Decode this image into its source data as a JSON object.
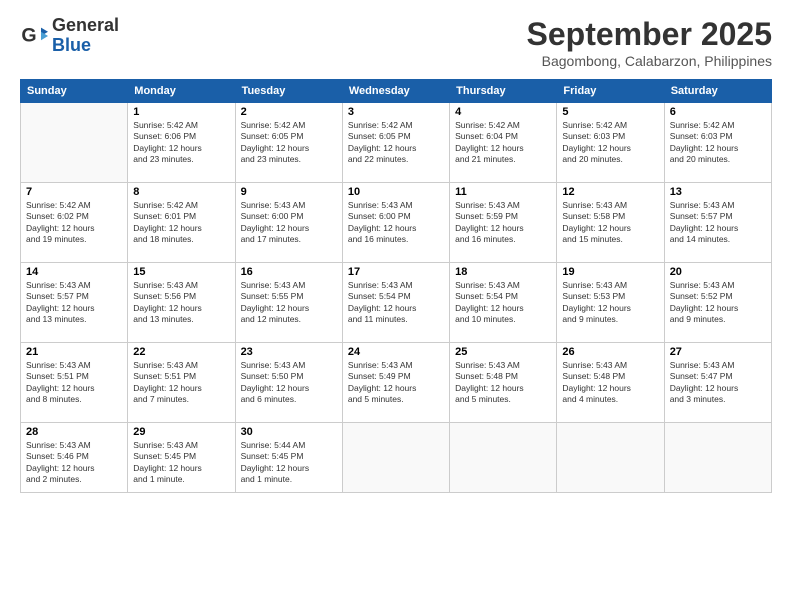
{
  "header": {
    "logo": {
      "general": "General",
      "blue": "Blue"
    },
    "title": "September 2025",
    "location": "Bagombong, Calabarzon, Philippines"
  },
  "days_of_week": [
    "Sunday",
    "Monday",
    "Tuesday",
    "Wednesday",
    "Thursday",
    "Friday",
    "Saturday"
  ],
  "weeks": [
    [
      {
        "num": "",
        "info": ""
      },
      {
        "num": "1",
        "info": "Sunrise: 5:42 AM\nSunset: 6:06 PM\nDaylight: 12 hours\nand 23 minutes."
      },
      {
        "num": "2",
        "info": "Sunrise: 5:42 AM\nSunset: 6:05 PM\nDaylight: 12 hours\nand 23 minutes."
      },
      {
        "num": "3",
        "info": "Sunrise: 5:42 AM\nSunset: 6:05 PM\nDaylight: 12 hours\nand 22 minutes."
      },
      {
        "num": "4",
        "info": "Sunrise: 5:42 AM\nSunset: 6:04 PM\nDaylight: 12 hours\nand 21 minutes."
      },
      {
        "num": "5",
        "info": "Sunrise: 5:42 AM\nSunset: 6:03 PM\nDaylight: 12 hours\nand 20 minutes."
      },
      {
        "num": "6",
        "info": "Sunrise: 5:42 AM\nSunset: 6:03 PM\nDaylight: 12 hours\nand 20 minutes."
      }
    ],
    [
      {
        "num": "7",
        "info": "Sunrise: 5:42 AM\nSunset: 6:02 PM\nDaylight: 12 hours\nand 19 minutes."
      },
      {
        "num": "8",
        "info": "Sunrise: 5:42 AM\nSunset: 6:01 PM\nDaylight: 12 hours\nand 18 minutes."
      },
      {
        "num": "9",
        "info": "Sunrise: 5:43 AM\nSunset: 6:00 PM\nDaylight: 12 hours\nand 17 minutes."
      },
      {
        "num": "10",
        "info": "Sunrise: 5:43 AM\nSunset: 6:00 PM\nDaylight: 12 hours\nand 16 minutes."
      },
      {
        "num": "11",
        "info": "Sunrise: 5:43 AM\nSunset: 5:59 PM\nDaylight: 12 hours\nand 16 minutes."
      },
      {
        "num": "12",
        "info": "Sunrise: 5:43 AM\nSunset: 5:58 PM\nDaylight: 12 hours\nand 15 minutes."
      },
      {
        "num": "13",
        "info": "Sunrise: 5:43 AM\nSunset: 5:57 PM\nDaylight: 12 hours\nand 14 minutes."
      }
    ],
    [
      {
        "num": "14",
        "info": "Sunrise: 5:43 AM\nSunset: 5:57 PM\nDaylight: 12 hours\nand 13 minutes."
      },
      {
        "num": "15",
        "info": "Sunrise: 5:43 AM\nSunset: 5:56 PM\nDaylight: 12 hours\nand 13 minutes."
      },
      {
        "num": "16",
        "info": "Sunrise: 5:43 AM\nSunset: 5:55 PM\nDaylight: 12 hours\nand 12 minutes."
      },
      {
        "num": "17",
        "info": "Sunrise: 5:43 AM\nSunset: 5:54 PM\nDaylight: 12 hours\nand 11 minutes."
      },
      {
        "num": "18",
        "info": "Sunrise: 5:43 AM\nSunset: 5:54 PM\nDaylight: 12 hours\nand 10 minutes."
      },
      {
        "num": "19",
        "info": "Sunrise: 5:43 AM\nSunset: 5:53 PM\nDaylight: 12 hours\nand 9 minutes."
      },
      {
        "num": "20",
        "info": "Sunrise: 5:43 AM\nSunset: 5:52 PM\nDaylight: 12 hours\nand 9 minutes."
      }
    ],
    [
      {
        "num": "21",
        "info": "Sunrise: 5:43 AM\nSunset: 5:51 PM\nDaylight: 12 hours\nand 8 minutes."
      },
      {
        "num": "22",
        "info": "Sunrise: 5:43 AM\nSunset: 5:51 PM\nDaylight: 12 hours\nand 7 minutes."
      },
      {
        "num": "23",
        "info": "Sunrise: 5:43 AM\nSunset: 5:50 PM\nDaylight: 12 hours\nand 6 minutes."
      },
      {
        "num": "24",
        "info": "Sunrise: 5:43 AM\nSunset: 5:49 PM\nDaylight: 12 hours\nand 5 minutes."
      },
      {
        "num": "25",
        "info": "Sunrise: 5:43 AM\nSunset: 5:48 PM\nDaylight: 12 hours\nand 5 minutes."
      },
      {
        "num": "26",
        "info": "Sunrise: 5:43 AM\nSunset: 5:48 PM\nDaylight: 12 hours\nand 4 minutes."
      },
      {
        "num": "27",
        "info": "Sunrise: 5:43 AM\nSunset: 5:47 PM\nDaylight: 12 hours\nand 3 minutes."
      }
    ],
    [
      {
        "num": "28",
        "info": "Sunrise: 5:43 AM\nSunset: 5:46 PM\nDaylight: 12 hours\nand 2 minutes."
      },
      {
        "num": "29",
        "info": "Sunrise: 5:43 AM\nSunset: 5:45 PM\nDaylight: 12 hours\nand 1 minute."
      },
      {
        "num": "30",
        "info": "Sunrise: 5:44 AM\nSunset: 5:45 PM\nDaylight: 12 hours\nand 1 minute."
      },
      {
        "num": "",
        "info": ""
      },
      {
        "num": "",
        "info": ""
      },
      {
        "num": "",
        "info": ""
      },
      {
        "num": "",
        "info": ""
      }
    ]
  ]
}
